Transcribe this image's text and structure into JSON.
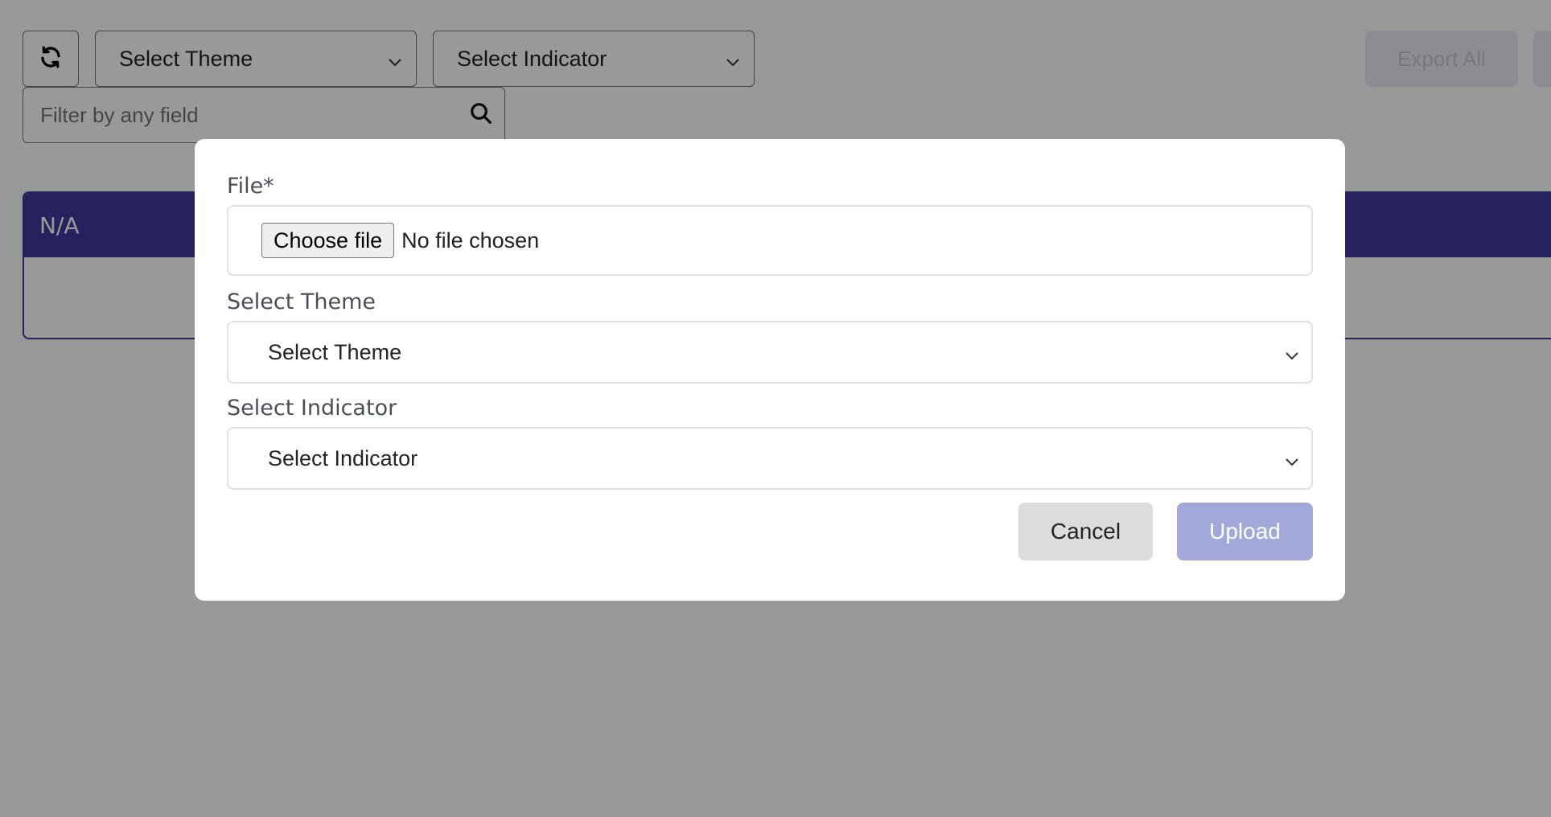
{
  "toolbar": {
    "theme_select": "Select Theme",
    "indicator_select": "Select Indicator",
    "filter_placeholder": "Filter by any field",
    "export_label": "Export All"
  },
  "table": {
    "header": "N/A"
  },
  "modal": {
    "file_label": "File*",
    "file_button": "Choose file",
    "file_status": "No file chosen",
    "theme_label": "Select Theme",
    "theme_value": "Select Theme",
    "indicator_label": "Select Indicator",
    "indicator_value": "Select Indicator",
    "cancel_label": "Cancel",
    "upload_label": "Upload"
  },
  "colors": {
    "primary": "#3f3a9c",
    "upload_disabled": "#a3a8db",
    "backdrop": "rgba(0,0,0,0.4)"
  },
  "icons": [
    "refresh-icon",
    "chevron-down-icon",
    "search-icon"
  ]
}
